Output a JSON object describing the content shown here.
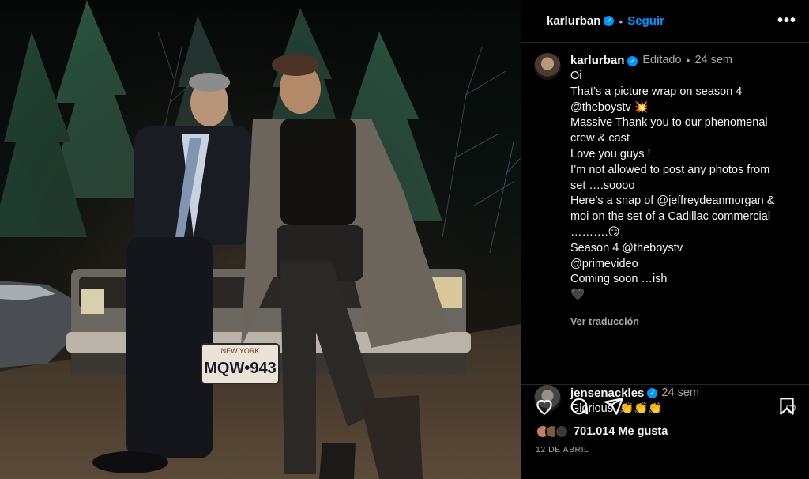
{
  "post": {
    "author": "karlurban",
    "follow_label": "Seguir",
    "more_label": "•••",
    "edited_label": "Editado",
    "time_ago": "24 sem",
    "caption_lines": [
      "Oi",
      "That’s a picture wrap on season 4",
      "@theboystv 💥",
      "Massive Thank you to our phenomenal",
      "crew & cast",
      "Love you guys !",
      "I’m not allowed to post any photos from",
      "set ….soooo",
      "Here’s a snap of @jeffreydeanmorgan &",
      "moi on the set of a Cadillac commercial",
      "……….😏",
      "Season 4 @theboystv",
      "@primevideo",
      "Coming soon …ish",
      "🖤"
    ],
    "translate_label": "Ver traducción",
    "license_plate_state": "NEW YORK",
    "license_plate_number": "MQW•943"
  },
  "comment": {
    "author": "jensenackles",
    "time_ago": "24 sem",
    "text": "Glorious. 👏👏👏"
  },
  "stats": {
    "likes_label": "701.014 Me gusta",
    "date_label": "12 DE ABRIL"
  },
  "colors": {
    "accent": "#0095f6",
    "background": "#000000",
    "divider": "#262626",
    "secondary_text": "#a8a8a8"
  },
  "icons": [
    "heart-icon",
    "comment-icon",
    "share-icon",
    "bookmark-icon",
    "verified-icon",
    "more-icon"
  ]
}
